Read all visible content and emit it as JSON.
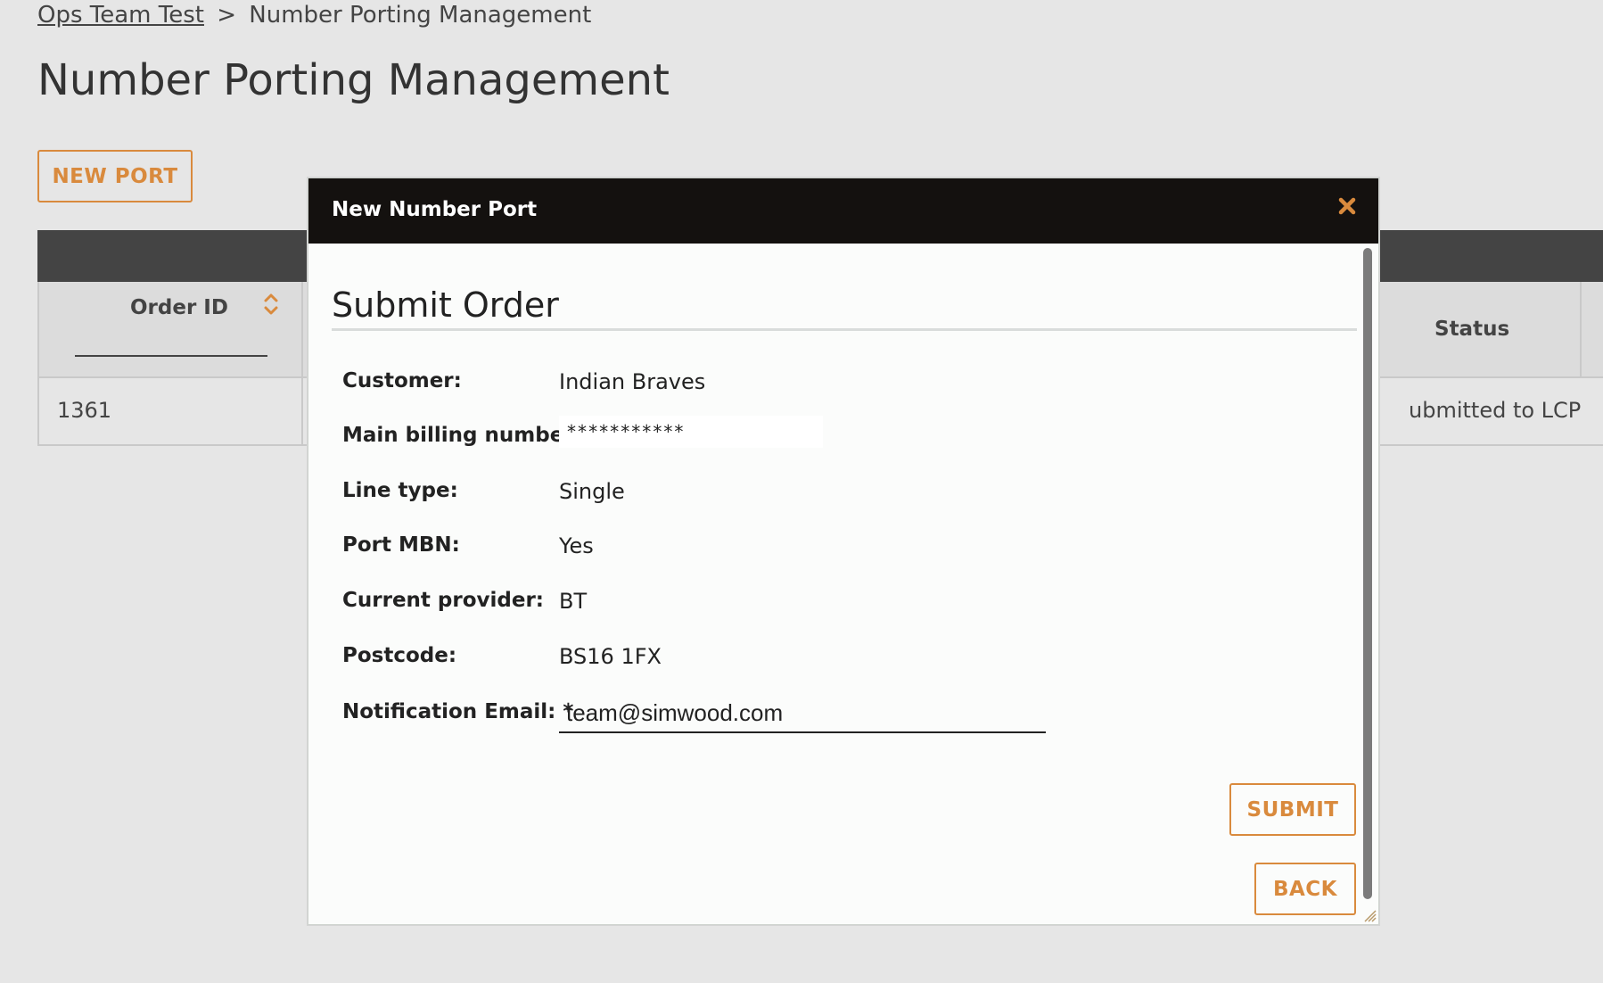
{
  "breadcrumb": {
    "parent": "Ops Team Test",
    "separator": ">",
    "current": "Number Porting Management"
  },
  "page": {
    "title": "Number Porting Management",
    "new_port_label": "NEW PORT"
  },
  "table": {
    "columns": {
      "order_id": "Order ID",
      "status": "Status"
    },
    "rows": [
      {
        "order_id": "1361",
        "status": "ubmitted to LCP"
      }
    ]
  },
  "modal": {
    "title": "New Number Port",
    "section_title": "Submit Order",
    "fields": {
      "customer": {
        "label": "Customer:",
        "value": "Indian Braves"
      },
      "main_billing_number": {
        "label": "Main billing number:",
        "value": "***********"
      },
      "line_type": {
        "label": "Line type:",
        "value": "Single"
      },
      "port_mbn": {
        "label": "Port MBN:",
        "value": "Yes"
      },
      "current_provider": {
        "label": "Current provider:",
        "value": "BT"
      },
      "postcode": {
        "label": "Postcode:",
        "value": "BS16 1FX"
      },
      "notification_email": {
        "label": "Notification Email: *",
        "value": "team@simwood.com"
      }
    },
    "submit_label": "SUBMIT",
    "back_label": "BACK"
  },
  "colors": {
    "accent": "#d98a3d",
    "titlebar": "#14110f",
    "table_header": "#444444",
    "background": "#e6e6e6"
  },
  "icons": {
    "close": "close-icon",
    "sort": "sort-icon",
    "resize": "resize-grip-icon"
  }
}
